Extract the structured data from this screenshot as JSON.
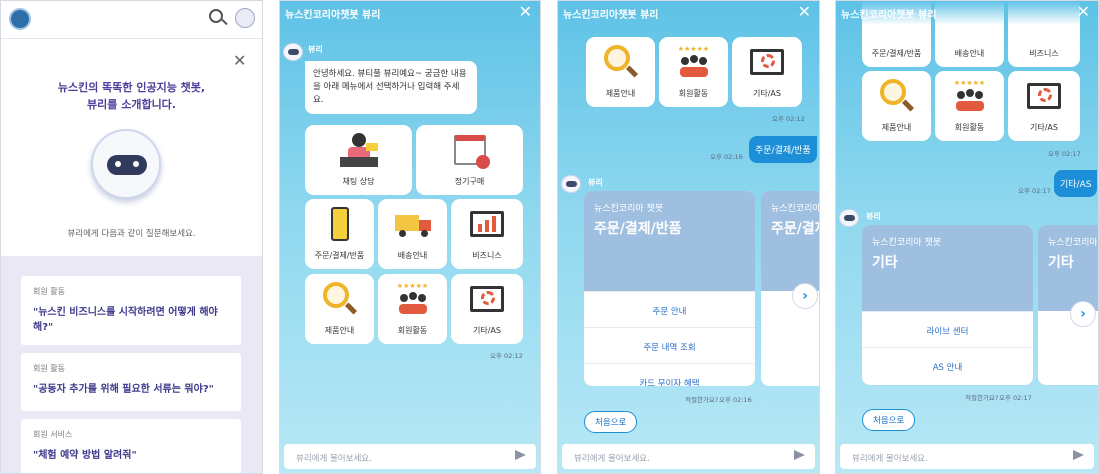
{
  "panel1": {
    "intro_line1": "뉴스킨의 똑똑한 인공지능 챗봇,",
    "intro_line2": "뷰리를 소개합니다.",
    "prompt": "뷰리에게 다음과 같이 질문해보세요.",
    "questions": [
      {
        "category": "회원 활동",
        "text": "\"뉴스킨 비즈니스를 시작하려면 어떻게 해야 해?\""
      },
      {
        "category": "회원 활동",
        "text": "\"공동자 추가를 위해 필요한 서류는 뭐야?\""
      },
      {
        "category": "회원 서비스",
        "text": "\"체험 예약 방법 알려줘\""
      }
    ]
  },
  "chat_title": "뉴스킨코리아챗봇 뷰리",
  "bot_name": "뷰리",
  "input_placeholder": "뷰리에게 물어보세요.",
  "panel2": {
    "greeting": "안녕하세요. 뷰티풀 뷰리예요~ 궁금한 내용을 아래 메뉴에서 선택하거나 입력해 주세요.",
    "menu": [
      "채팅 상담",
      "정기구매",
      "주문/결제/반품",
      "배송안내",
      "비즈니스",
      "제품안내",
      "회원활동",
      "기타/AS"
    ],
    "time": "오후 02:12"
  },
  "panel3": {
    "tiles": [
      "제품안내",
      "회원활동",
      "기타/AS"
    ],
    "time_tiles": "오후 02:12",
    "user_msg": "주문/결제/반품",
    "user_time": "오후 02:16",
    "card_brand": "뉴스킨코리아 챗봇",
    "card_title": "주문/결제/반품",
    "card_rows": [
      "주문 안내",
      "주문 내역 조회",
      "카드 무이자 혜택"
    ],
    "peek_brand": "뉴스킨코리아 챗봇",
    "peek_title": "주문/결제",
    "feedback": "적절한가요?",
    "time_card": "오후 02:16",
    "first_button": "처음으로"
  },
  "panel4": {
    "top_tiles": [
      "주문/결제/반품",
      "배송안내",
      "비즈니스"
    ],
    "tiles": [
      "제품안내",
      "회원활동",
      "기타/AS"
    ],
    "time_tiles": "오후 02:17",
    "user_msg": "기타/AS",
    "user_time": "오후 02:17",
    "card_brand": "뉴스킨코리아 챗봇",
    "card_title": "기타",
    "card_rows": [
      "라이브 센터",
      "AS 안내"
    ],
    "peek_brand": "뉴스킨코리아 챗봇",
    "peek_title": "기타",
    "feedback": "적절한가요?",
    "time_card": "오후 02:17",
    "first_button": "처음으로"
  }
}
